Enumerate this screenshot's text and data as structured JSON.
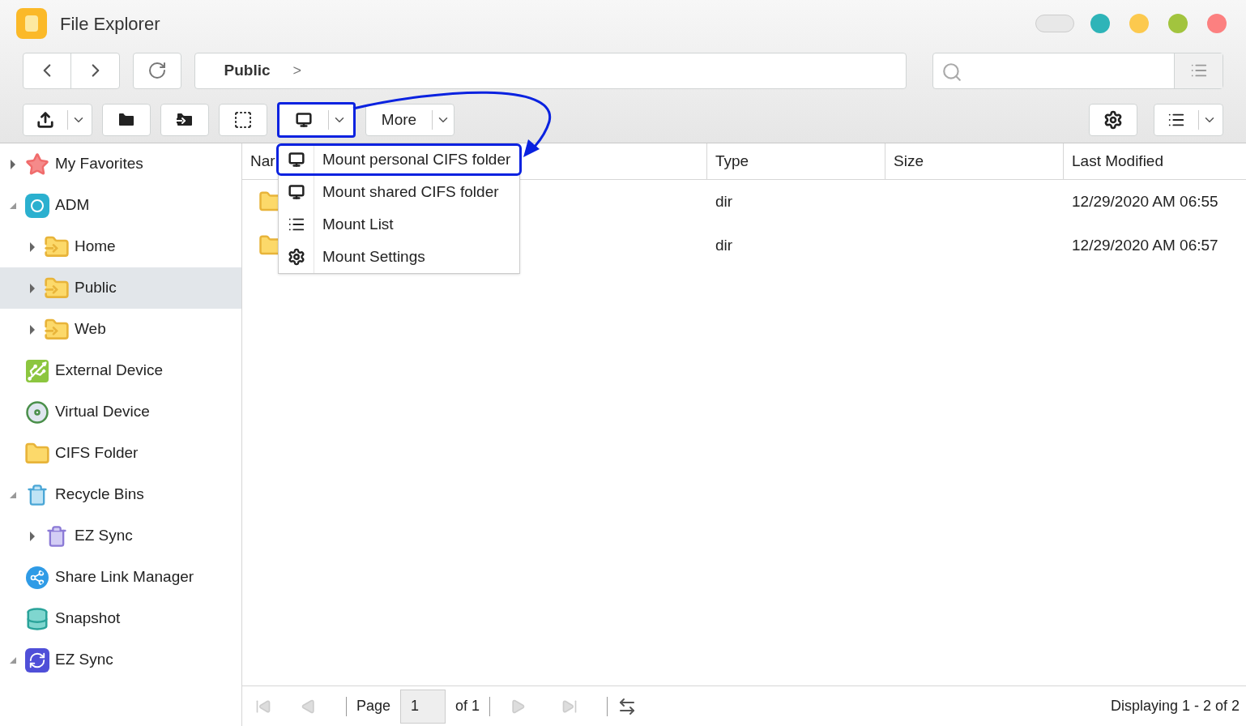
{
  "window": {
    "title": "File Explorer"
  },
  "breadcrumb": {
    "path": "Public",
    "separator": ">"
  },
  "toolbar": {
    "more": "More",
    "mount_highlighted": true
  },
  "mount_menu": [
    {
      "label": "Mount personal CIFS folder",
      "kind": "mount",
      "highlighted": true
    },
    {
      "label": "Mount shared CIFS folder",
      "kind": "mount",
      "highlighted": false
    },
    {
      "label": "Mount List",
      "kind": "list",
      "highlighted": false
    },
    {
      "label": "Mount Settings",
      "kind": "settings",
      "highlighted": false
    }
  ],
  "sidebar": {
    "items": [
      {
        "label": "My Favorites",
        "kind": "star",
        "expanded": false,
        "selected": false
      },
      {
        "label": "ADM",
        "kind": "adm",
        "expanded": true,
        "selected": false,
        "children": [
          {
            "label": "Home",
            "kind": "share",
            "expanded": false,
            "selected": false
          },
          {
            "label": "Public",
            "kind": "share",
            "expanded": false,
            "selected": true
          },
          {
            "label": "Web",
            "kind": "share",
            "expanded": false,
            "selected": false
          }
        ]
      },
      {
        "label": "External Device",
        "kind": "usb",
        "selected": false
      },
      {
        "label": "Virtual Device",
        "kind": "disc",
        "selected": false
      },
      {
        "label": "CIFS Folder",
        "kind": "folder",
        "selected": false
      },
      {
        "label": "Recycle Bins",
        "kind": "bin",
        "expanded": true,
        "selected": false,
        "children": [
          {
            "label": "EZ Sync",
            "kind": "bin2",
            "expanded": false,
            "selected": false
          }
        ]
      },
      {
        "label": "Share Link Manager",
        "kind": "sharelink",
        "selected": false
      },
      {
        "label": "Snapshot",
        "kind": "snapshot",
        "selected": false
      },
      {
        "label": "EZ Sync",
        "kind": "ezsync",
        "expanded": true,
        "selected": false
      }
    ]
  },
  "table": {
    "columns": [
      "Nar",
      "Type",
      "Size",
      "Last Modified"
    ],
    "rows": [
      {
        "type": "dir",
        "size": "",
        "modified": "12/29/2020 AM 06:55"
      },
      {
        "type": "dir",
        "size": "",
        "modified": "12/29/2020 AM 06:57"
      }
    ]
  },
  "pager": {
    "page_label": "Page",
    "page": "1",
    "of": "of 1",
    "display": "Displaying 1 - 2 of 2"
  }
}
